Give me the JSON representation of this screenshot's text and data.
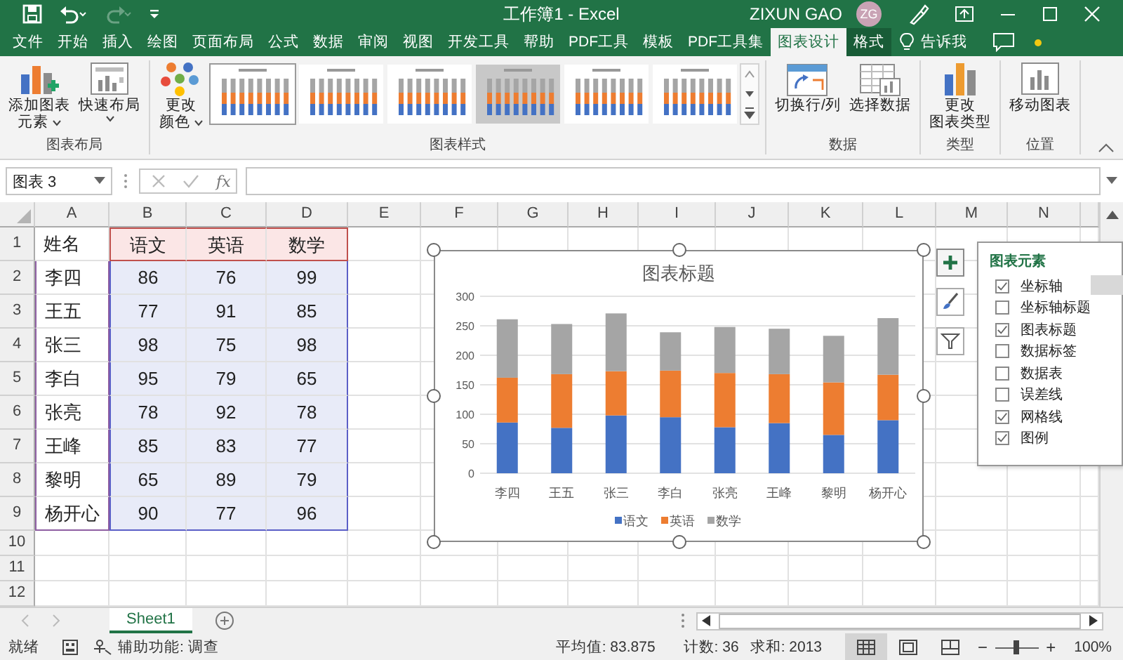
{
  "title_bar": {
    "title": "工作簿1 - Excel",
    "user": "ZIXUN GAO",
    "avatar": "ZG"
  },
  "tabs": [
    {
      "label": "文件",
      "selected": false,
      "kind": "normal"
    },
    {
      "label": "开始",
      "selected": false,
      "kind": "normal"
    },
    {
      "label": "插入",
      "selected": false,
      "kind": "normal"
    },
    {
      "label": "绘图",
      "selected": false,
      "kind": "normal"
    },
    {
      "label": "页面布局",
      "selected": false,
      "kind": "normal"
    },
    {
      "label": "公式",
      "selected": false,
      "kind": "normal"
    },
    {
      "label": "数据",
      "selected": false,
      "kind": "normal"
    },
    {
      "label": "审阅",
      "selected": false,
      "kind": "normal"
    },
    {
      "label": "视图",
      "selected": false,
      "kind": "normal"
    },
    {
      "label": "开发工具",
      "selected": false,
      "kind": "normal"
    },
    {
      "label": "帮助",
      "selected": false,
      "kind": "normal"
    },
    {
      "label": "PDF工具",
      "selected": false,
      "kind": "normal"
    },
    {
      "label": "模板",
      "selected": false,
      "kind": "normal"
    },
    {
      "label": "PDF工具集",
      "selected": false,
      "kind": "normal"
    },
    {
      "label": "图表设计",
      "selected": true,
      "kind": "contextual"
    },
    {
      "label": "格式",
      "selected": false,
      "kind": "contextual"
    }
  ],
  "tell_me": "告诉我",
  "ribbon": {
    "groups": [
      {
        "label": "图表布局",
        "items": [
          {
            "kind": "button",
            "lines": [
              "添加图表",
              "元素"
            ],
            "dropdown": true
          },
          {
            "kind": "button",
            "lines": [
              "快速布局"
            ],
            "dropdown": true
          }
        ]
      },
      {
        "label": "图表样式",
        "items": [
          {
            "kind": "button",
            "lines": [
              "更改",
              "颜色"
            ],
            "dropdown": true
          },
          {
            "kind": "gallery",
            "styles": [
              {
                "kind": "plain",
                "selected": true
              },
              {
                "kind": "plain",
                "selected": false
              },
              {
                "kind": "plain",
                "selected": false
              },
              {
                "kind": "shaded",
                "selected": false
              },
              {
                "kind": "plain",
                "selected": false
              },
              {
                "kind": "plain",
                "selected": false
              }
            ]
          }
        ]
      },
      {
        "label": "数据",
        "items": [
          {
            "kind": "button",
            "lines": [
              "切换行/列"
            ],
            "dropdown": false
          },
          {
            "kind": "button",
            "lines": [
              "选择数据"
            ],
            "dropdown": false
          }
        ]
      },
      {
        "label": "类型",
        "items": [
          {
            "kind": "button",
            "lines": [
              "更改",
              "图表类型"
            ],
            "dropdown": false
          }
        ]
      },
      {
        "label": "位置",
        "items": [
          {
            "kind": "button",
            "lines": [
              "移动图表"
            ],
            "dropdown": false
          }
        ]
      }
    ]
  },
  "formula_bar": {
    "name_box": "图表 3",
    "function_label": "fx"
  },
  "sheet": {
    "columns": [
      "A",
      "B",
      "C",
      "D",
      "E",
      "F",
      "G",
      "H",
      "I",
      "J",
      "K",
      "L",
      "M",
      "N"
    ],
    "rows": [
      {
        "number": "1",
        "kind": "header",
        "cells": [
          "姓名",
          "语文",
          "英语",
          "数学"
        ]
      },
      {
        "number": "2",
        "kind": "values",
        "cells": [
          "李四",
          "86",
          "76",
          "99"
        ]
      },
      {
        "number": "3",
        "kind": "values",
        "cells": [
          "王五",
          "77",
          "91",
          "85"
        ]
      },
      {
        "number": "4",
        "kind": "values",
        "cells": [
          "张三",
          "98",
          "75",
          "98"
        ]
      },
      {
        "number": "5",
        "kind": "values",
        "cells": [
          "李白",
          "95",
          "79",
          "65"
        ]
      },
      {
        "number": "6",
        "kind": "values",
        "cells": [
          "张亮",
          "78",
          "92",
          "78"
        ]
      },
      {
        "number": "7",
        "kind": "values",
        "cells": [
          "王峰",
          "85",
          "83",
          "77"
        ]
      },
      {
        "number": "8",
        "kind": "values",
        "cells": [
          "黎明",
          "65",
          "89",
          "79"
        ]
      },
      {
        "number": "9",
        "kind": "values",
        "cells": [
          "杨开心",
          "90",
          "77",
          "96"
        ]
      },
      {
        "number": "10",
        "kind": "plain",
        "cells": []
      },
      {
        "number": "11",
        "kind": "plain",
        "cells": []
      },
      {
        "number": "12",
        "kind": "plain",
        "cells": []
      }
    ]
  },
  "chart": {
    "selected": true,
    "chart_data": {
      "type": "bar",
      "title": "图表标题",
      "stacked": true,
      "grid": true,
      "legend": true,
      "categories": [
        "李四",
        "王五",
        "张三",
        "李白",
        "张亮",
        "王峰",
        "黎明",
        "杨开心"
      ],
      "series": [
        {
          "name": "语文",
          "color": "#4472c4",
          "values": [
            86,
            77,
            98,
            95,
            78,
            85,
            65,
            90
          ]
        },
        {
          "name": "英语",
          "color": "#ed7d31",
          "values": [
            76,
            91,
            75,
            79,
            92,
            83,
            89,
            77
          ]
        },
        {
          "name": "数学",
          "color": "#a5a5a5",
          "values": [
            99,
            85,
            98,
            65,
            78,
            77,
            79,
            96
          ]
        }
      ],
      "ylim": [
        0,
        300
      ],
      "yticks": [
        0,
        50,
        100,
        150,
        200,
        250,
        300
      ]
    }
  },
  "chart_buttons": [
    {
      "kind": "plus",
      "selected": true
    },
    {
      "kind": "brush",
      "selected": false
    },
    {
      "kind": "filter",
      "selected": false
    }
  ],
  "elements_panel": {
    "title": "图表元素",
    "items": [
      {
        "label": "坐标轴",
        "checked": true,
        "hovered": true
      },
      {
        "label": "坐标轴标题",
        "checked": false,
        "hovered": false
      },
      {
        "label": "图表标题",
        "checked": true,
        "hovered": false
      },
      {
        "label": "数据标签",
        "checked": false,
        "hovered": false
      },
      {
        "label": "数据表",
        "checked": false,
        "hovered": false
      },
      {
        "label": "误差线",
        "checked": false,
        "hovered": false
      },
      {
        "label": "网格线",
        "checked": true,
        "hovered": false
      },
      {
        "label": "图例",
        "checked": true,
        "hovered": false
      }
    ]
  },
  "sheet_tabs": [
    {
      "label": "Sheet1",
      "selected": true
    }
  ],
  "status_bar": {
    "ready": "就绪",
    "accessibility": "辅助功能: 调查",
    "average": "平均值: 83.875",
    "count": "计数: 36",
    "sum": "求和: 2013",
    "views": [
      {
        "kind": "normal",
        "selected": true
      },
      {
        "kind": "page_layout",
        "selected": false
      },
      {
        "kind": "page_break",
        "selected": false
      }
    ],
    "zoom_out": "−",
    "zoom_in": "+",
    "zoom": {
      "level": 0.5,
      "label": "100%"
    }
  }
}
